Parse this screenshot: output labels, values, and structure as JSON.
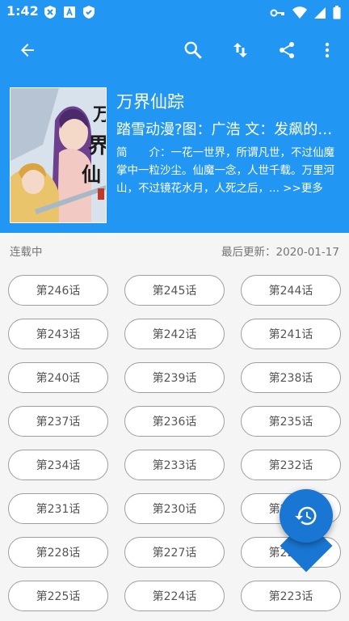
{
  "status_bar": {
    "time": "1:42",
    "left_icons": [
      "close-notif-icon",
      "a-notif-icon",
      "shield-notif-icon"
    ],
    "right_icons": [
      "key-icon",
      "wifi-icon",
      "signal-icon",
      "battery-icon"
    ]
  },
  "toolbar": {
    "icons": [
      "back-arrow-icon",
      "search-icon",
      "sort-icon",
      "share-icon",
      "more-vert-icon"
    ]
  },
  "comic": {
    "title": "万界仙踪",
    "author": "踏雪动漫?图：广浩 文：发飙的蜗牛",
    "description": "简　　介：一花一世界，所谓凡世，不过仙魔掌中一粒沙尘。仙魔一念，人世千载。万里河山，不过镜花水月，人死之后，... >>更多"
  },
  "status": {
    "state": "连载中",
    "last_update": "最后更新：2020-01-17"
  },
  "chapters": [
    "第246话",
    "第245话",
    "第244话",
    "第243话",
    "第242话",
    "第241话",
    "第240话",
    "第239话",
    "第238话",
    "第237话",
    "第236话",
    "第235话",
    "第234话",
    "第233话",
    "第232话",
    "第231话",
    "第230话",
    "第229话",
    "第228话",
    "第227话",
    "第226话",
    "第225话",
    "第224话",
    "第223话"
  ],
  "colors": {
    "primary": "#2196f3",
    "fab": "#1976d2"
  }
}
